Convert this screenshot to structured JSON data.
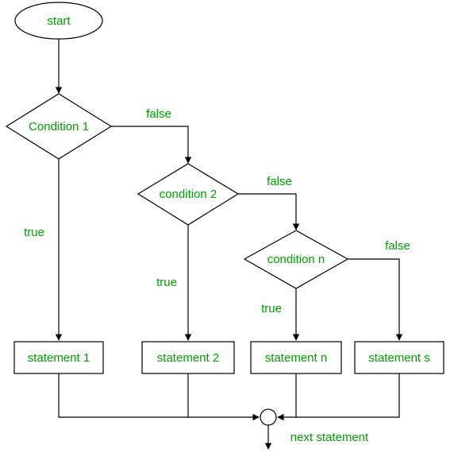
{
  "diagram": {
    "start": "start",
    "cond1": "Condition 1",
    "cond2": "condition 2",
    "condn": "condition n",
    "stmt1": "statement 1",
    "stmt2": "statement 2",
    "stmtn": "statement n",
    "stmts": "statement s",
    "next": "next statement",
    "true": "true",
    "false": "false"
  }
}
